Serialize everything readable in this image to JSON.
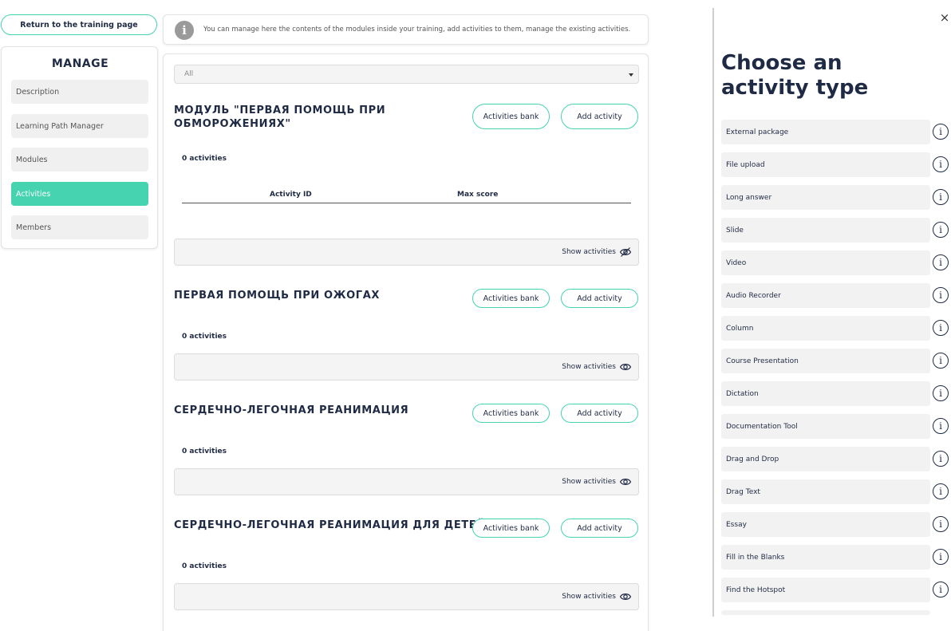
{
  "return_button": "Return to the training page",
  "info_text": "You can manage here the contents of the modules inside your training, add activities to them, manage the existing activities.",
  "manage": {
    "title": "MANAGE",
    "items": [
      {
        "label": "Description",
        "active": false
      },
      {
        "label": "Learning Path Manager",
        "active": false
      },
      {
        "label": "Modules",
        "active": false
      },
      {
        "label": "Activities",
        "active": true
      },
      {
        "label": "Members",
        "active": false
      }
    ]
  },
  "filter": {
    "value": "All"
  },
  "table_headers": {
    "activity_id": "Activity ID",
    "max_score": "Max score"
  },
  "modules": [
    {
      "title": "МОДУЛЬ \"ПЕРВАЯ ПОМОЩЬ ПРИ ОБМОРОЖЕНИЯХ\"",
      "count": "0 activities",
      "bank": "Activities bank",
      "add": "Add activity",
      "show": "Show activities"
    },
    {
      "title": "ПЕРВАЯ ПОМОЩЬ ПРИ ОЖОГАХ",
      "count": "0 activities",
      "bank": "Activities bank",
      "add": "Add activity",
      "show": "Show activities"
    },
    {
      "title": "СЕРДЕЧНО-ЛЕГОЧНАЯ РЕАНИМАЦИЯ",
      "count": "0 activities",
      "bank": "Activities bank",
      "add": "Add activity",
      "show": "Show activities"
    },
    {
      "title": "СЕРДЕЧНО-ЛЕГОЧНАЯ РЕАНИМАЦИЯ ДЛЯ ДЕТЕЙ",
      "count": "0 activities",
      "bank": "Activities bank",
      "add": "Add activity",
      "show": "Show activities"
    }
  ],
  "panel": {
    "title": "Choose an activity type",
    "close": "×",
    "activities": [
      "External package",
      "File upload",
      "Long answer",
      "Slide",
      "Video",
      "Audio Recorder",
      "Column",
      "Course Presentation",
      "Dictation",
      "Documentation Tool",
      "Drag and Drop",
      "Drag Text",
      "Essay",
      "Fill in the Blanks",
      "Find the Hotspot"
    ]
  },
  "colors": {
    "accent": "#46d3b0",
    "text": "#1f2a44"
  }
}
